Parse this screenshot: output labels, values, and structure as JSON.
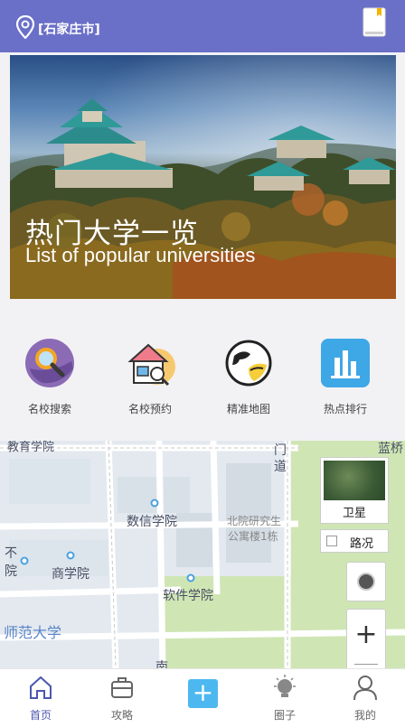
{
  "header": {
    "location": "[石家庄市]"
  },
  "banner": {
    "title": "热门大学一览",
    "subtitle": "List of popular universities"
  },
  "quick_links": [
    {
      "label": "名校搜索",
      "icon": "search-magnifier-icon"
    },
    {
      "label": "名校预约",
      "icon": "school-house-icon"
    },
    {
      "label": "精准地图",
      "icon": "globe-map-icon"
    },
    {
      "label": "热点排行",
      "icon": "bar-chart-icon"
    }
  ],
  "map": {
    "labels": {
      "school_top": "教育学院",
      "lanqiao": "蓝桥",
      "dao": "道",
      "men": "门",
      "shuxin": "数信学院",
      "beiyuan": "北院研究生",
      "gongyu": "公寓楼1栋",
      "bu": "不",
      "yuan": "院",
      "shang": "商学院",
      "ruanjian": "软件学院",
      "shifan": "师范大学",
      "nan": "南"
    },
    "satellite_label": "卫星",
    "traffic_label": "路况",
    "zoom_in_label": "+"
  },
  "tabs": [
    {
      "label": "首页",
      "icon": "home-icon",
      "active": true
    },
    {
      "label": "攻略",
      "icon": "briefcase-icon",
      "active": false
    },
    {
      "label": "",
      "icon": "plus-icon",
      "active": false
    },
    {
      "label": "圈子",
      "icon": "bulb-icon",
      "active": false
    },
    {
      "label": "我的",
      "icon": "user-icon",
      "active": false
    }
  ],
  "plus_label": "+",
  "colors": {
    "header": "#6a6fc8",
    "accent": "#4db8f0",
    "active_tab": "#4b57b0"
  }
}
